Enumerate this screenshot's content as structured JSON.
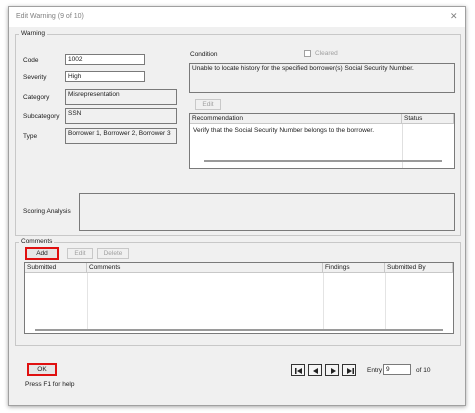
{
  "window": {
    "title": "Edit Warning  (9 of 10)",
    "close_glyph": "✕"
  },
  "warning": {
    "group_label": "Warning",
    "code_label": "Code",
    "code_value": "1002",
    "severity_label": "Severity",
    "severity_value": "High",
    "category_label": "Category",
    "category_value": "Misrepresentation",
    "subcategory_label": "Subcategory",
    "subcategory_value": "SSN",
    "type_label": "Type",
    "type_value": "Borrower 1, Borrower 2, Borrower 3",
    "condition_label": "Condition",
    "cleared_label": "Cleared",
    "condition_text": "Unable to locate history for the specified borrower(s) Social Security Number.",
    "edit_label": "Edit",
    "recommendation_columns": [
      "Recommendation",
      "Status"
    ],
    "recommendation_rows": [
      {
        "recommendation": "Verify that the Social Security Number belongs to the borrower.",
        "status": ""
      }
    ],
    "scoring_label": "Scoring Analysis"
  },
  "comments": {
    "group_label": "Comments",
    "add_label": "Add",
    "edit_label": "Edit",
    "delete_label": "Delete",
    "columns": [
      "Submitted",
      "Comments",
      "Findings",
      "Submitted By"
    ]
  },
  "footer": {
    "ok_label": "OK",
    "help_text": "Press F1 for help",
    "entry_label": "Entry",
    "entry_value": "9",
    "of_label": "of 10",
    "nav_icons": [
      "first-icon",
      "prev-icon",
      "next-icon",
      "last-icon"
    ]
  }
}
